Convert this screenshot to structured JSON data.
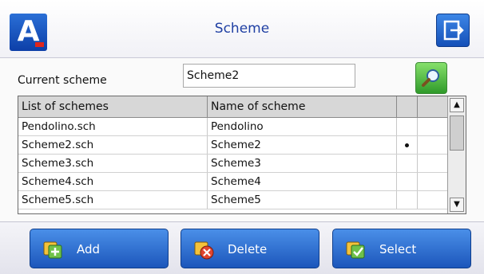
{
  "header": {
    "title": "Scheme",
    "logo_letter": "A",
    "exit_icon": "exit-icon"
  },
  "form": {
    "label": "Current scheme",
    "value": "Scheme2",
    "search_icon": "search-icon"
  },
  "table": {
    "columns": [
      "List of schemes",
      "Name of scheme",
      "",
      ""
    ],
    "rows": [
      {
        "file": "Pendolino.sch",
        "name": "Pendolino",
        "selected": false
      },
      {
        "file": "Scheme2.sch",
        "name": "Scheme2",
        "selected": true
      },
      {
        "file": "Scheme3.sch",
        "name": "Scheme3",
        "selected": false
      },
      {
        "file": "Scheme4.sch",
        "name": "Scheme4",
        "selected": false
      },
      {
        "file": "Scheme5.sch",
        "name": "Scheme5",
        "selected": false
      }
    ]
  },
  "toolbar": {
    "add": {
      "label": "Add",
      "icon": "add-icon"
    },
    "delete": {
      "label": "Delete",
      "icon": "delete-icon"
    },
    "select": {
      "label": "Select",
      "icon": "select-icon"
    }
  },
  "colors": {
    "accent": "#1c56bb",
    "title": "#1f3fa3",
    "logo_red": "#e0261c",
    "search": "#2f9a2a"
  }
}
